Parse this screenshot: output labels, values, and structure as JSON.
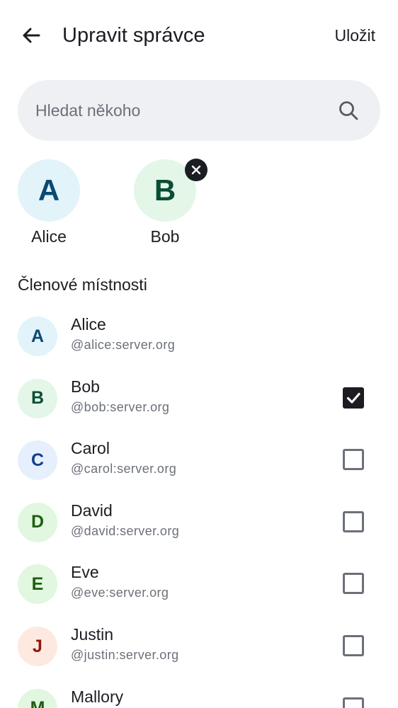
{
  "header": {
    "title": "Upravit správce",
    "save_label": "Uložit"
  },
  "search": {
    "placeholder": "Hledat někoho",
    "value": ""
  },
  "selected_users": [
    {
      "initial": "A",
      "name": "Alice",
      "bg": "#e2f3fa",
      "fg": "#0b4a72",
      "removable": false
    },
    {
      "initial": "B",
      "name": "Bob",
      "bg": "#e3f6e8",
      "fg": "#0a4d35",
      "removable": true
    }
  ],
  "section": {
    "title": "Členové místnosti"
  },
  "members": [
    {
      "initial": "A",
      "name": "Alice",
      "user_id": "@alice:server.org",
      "bg": "#e2f3fa",
      "fg": "#0b4a72",
      "checkbox": false,
      "checked": false
    },
    {
      "initial": "B",
      "name": "Bob",
      "user_id": "@bob:server.org",
      "bg": "#e3f6e8",
      "fg": "#0a4d35",
      "checkbox": true,
      "checked": true
    },
    {
      "initial": "C",
      "name": "Carol",
      "user_id": "@carol:server.org",
      "bg": "#e6f0fd",
      "fg": "#123f8c",
      "checkbox": true,
      "checked": false
    },
    {
      "initial": "D",
      "name": "David",
      "user_id": "@david:server.org",
      "bg": "#e1f7df",
      "fg": "#1f5d12",
      "checkbox": true,
      "checked": false
    },
    {
      "initial": "E",
      "name": "Eve",
      "user_id": "@eve:server.org",
      "bg": "#e1f7df",
      "fg": "#1f5d12",
      "checkbox": true,
      "checked": false
    },
    {
      "initial": "J",
      "name": "Justin",
      "user_id": "@justin:server.org",
      "bg": "#fde9df",
      "fg": "#8a1a12",
      "checkbox": true,
      "checked": false
    },
    {
      "initial": "M",
      "name": "Mallory",
      "user_id": "",
      "bg": "#e1f7df",
      "fg": "#1f5d12",
      "checkbox": true,
      "checked": false
    }
  ],
  "icons": {
    "back": "arrow-left-icon",
    "search": "magnifier-icon",
    "remove": "close-icon",
    "check": "check-icon"
  },
  "colors": {
    "text_primary": "#1b1d22",
    "text_secondary": "#6b7079",
    "search_bg": "#eff0f4"
  }
}
